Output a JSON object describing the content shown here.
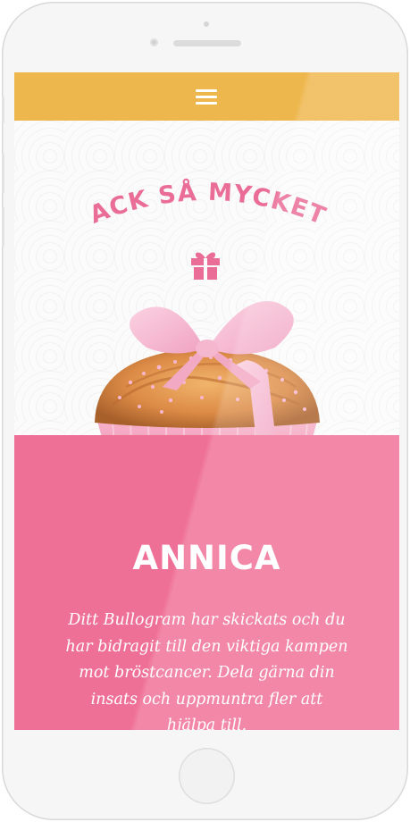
{
  "device": {
    "name": "phone-frame",
    "frame_color": "#f6f6f6"
  },
  "header": {
    "menu_icon": "hamburger-menu-icon",
    "background_color": "#eeb74e"
  },
  "hero": {
    "title": "TACK SÅ MYCKET!",
    "title_color": "#ea6d97",
    "gift_icon": "gift-icon",
    "image": "pink-ribbon-bun"
  },
  "content": {
    "recipient_name": "ANNICA",
    "message": "Ditt Bullogram har skickats och du har bidragit till den viktiga kampen mot bröstcancer. Dela gärna din insats och uppmuntra fler att hjälpa till.",
    "background_color": "#ef7096",
    "text_color": "#ffffff"
  }
}
